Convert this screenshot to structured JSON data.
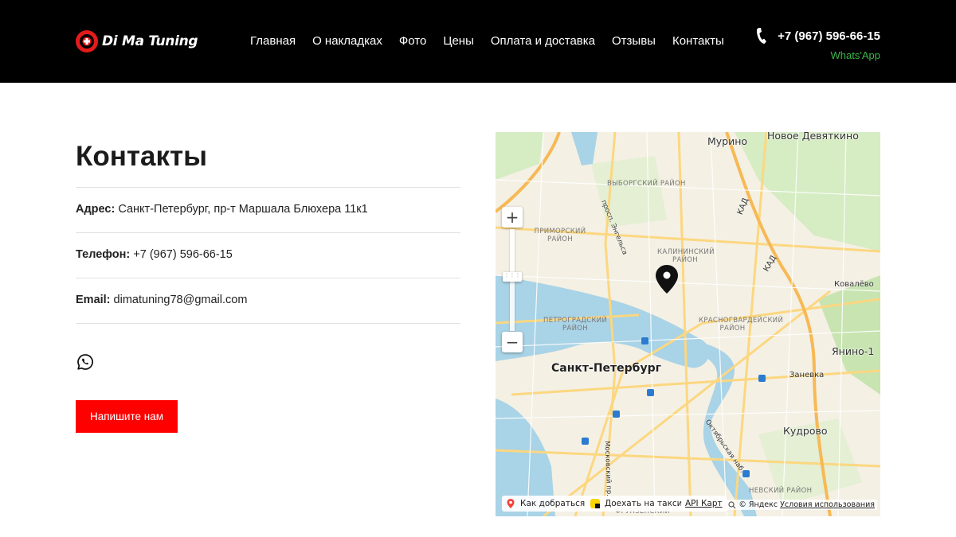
{
  "header": {
    "brand": "Di Ma Tuning",
    "nav": [
      "Главная",
      "О накладках",
      "Фото",
      "Цены",
      "Оплата и доставка",
      "Отзывы",
      "Контакты"
    ],
    "phone": "+7 (967) 596-66-15",
    "whatsapp_link": "Whats'App"
  },
  "contacts": {
    "title": "Контакты",
    "address_label": "Адрес:",
    "address_value": "Санкт-Петербург, пр-т Маршала Блюхера 11к1",
    "phone_label": "Телефон:",
    "phone_value": "+7 (967) 596-66-15",
    "email_label": "Email:",
    "email_value": "dimatuning78@gmail.com",
    "cta_button": "Напишите нам"
  },
  "map": {
    "labels": {
      "murino": "Мурино",
      "novoe_devyatkino": "Новое Девяткино",
      "city": "Санкт-Петербург",
      "kovalevo": "Ковалёво",
      "yanino": "Янино-1",
      "zanevka": "Заневка",
      "kudrovo": "Кудрово",
      "vyborgsky": "ВЫБОРГСКИЙ РАЙОН",
      "primorsky": "ПРИМОРСКИЙ РАЙОН",
      "kalininsky": "КАЛИНИНСКИЙ РАЙОН",
      "petrogradsky": "ПЕТРОГРАДСКИЙ РАЙОН",
      "krasnogvardeysky": "КРАСНОГВАРДЕЙСКИЙ РАЙОН",
      "kad": "КАД",
      "kad2": "КАД",
      "engelsa": "просп. Энгельса",
      "moskovsky": "Московский пр.",
      "oktyabrskaya": "Октябрьская наб.",
      "nevsky": "НЕВСКИЙ РАЙОН",
      "frunzensky": "ФРУНЗЕНСКИЙ"
    },
    "route_button": "Как добраться",
    "taxi_button": "Доехать на такси",
    "api_link": "API Карт",
    "copyright": "© Яндекс",
    "terms_link": "Условия использования"
  },
  "colors": {
    "header_bg": "#000000",
    "accent_red": "#ff0000",
    "whatsapp_green": "#3bb54a",
    "map_water": "#a9d3e6",
    "map_park": "#d6ecc3",
    "map_road": "#fcd780"
  }
}
